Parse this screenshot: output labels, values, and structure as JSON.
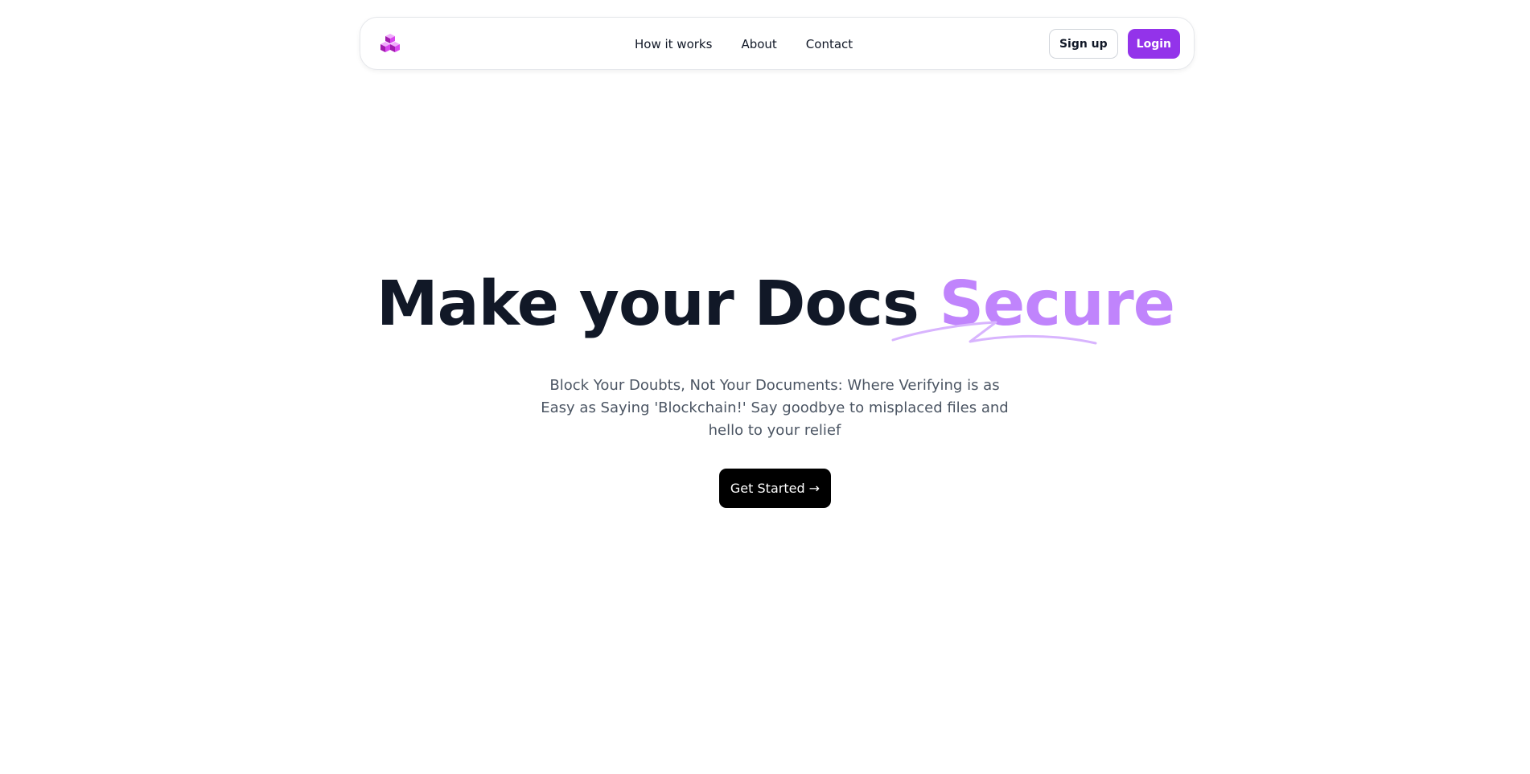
{
  "nav": {
    "logo_icon": "purple-cubes-logo-icon",
    "links": [
      "How it works",
      "About",
      "Contact"
    ],
    "signup_label": "Sign up",
    "login_label": "Login"
  },
  "hero": {
    "title_main": "Make your Docs ",
    "title_accent": "Secure",
    "subtitle": "Block Your Doubts, Not Your Documents: Where Verifying is as Easy as Saying 'Blockchain!' Say goodbye to misplaced files and hello to your relief",
    "cta_label": "Get Started →"
  },
  "colors": {
    "brand": "#9333ea",
    "accent_text": "#c084fc",
    "heading": "#111827",
    "subtitle": "#4b5563",
    "cta_bg": "#000000"
  }
}
